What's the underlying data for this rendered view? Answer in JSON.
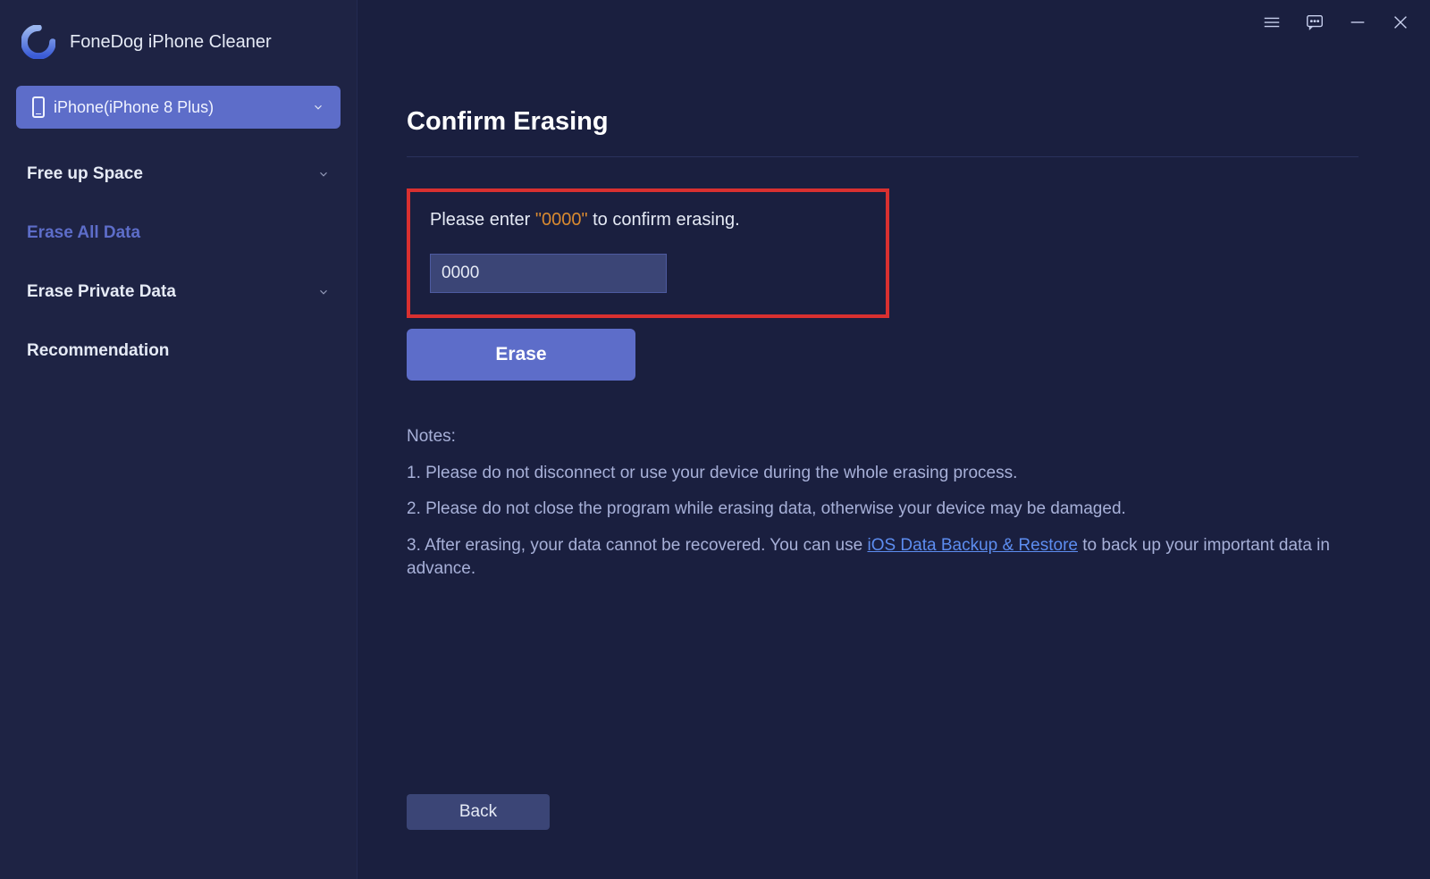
{
  "brand": {
    "title": "FoneDog iPhone Cleaner"
  },
  "device": {
    "label": "iPhone(iPhone 8 Plus)"
  },
  "nav": {
    "free_up": "Free up Space",
    "erase_all": "Erase All Data",
    "erase_private": "Erase Private Data",
    "recommendation": "Recommendation"
  },
  "page": {
    "title": "Confirm Erasing",
    "prompt_prefix": "Please enter ",
    "prompt_code_quoted": "\"0000\"",
    "prompt_suffix": " to confirm erasing.",
    "input_value": "0000",
    "erase_btn": "Erase",
    "back_btn": "Back"
  },
  "notes": {
    "heading": "Notes:",
    "n1": "1. Please do not disconnect or use your device during the whole erasing process.",
    "n2": "2. Please do not close the program while erasing data, otherwise your device may be damaged.",
    "n3_a": "3. After erasing, your data cannot be recovered. You can use ",
    "n3_link": "iOS Data Backup & Restore",
    "n3_b": " to back up your important data in advance."
  }
}
